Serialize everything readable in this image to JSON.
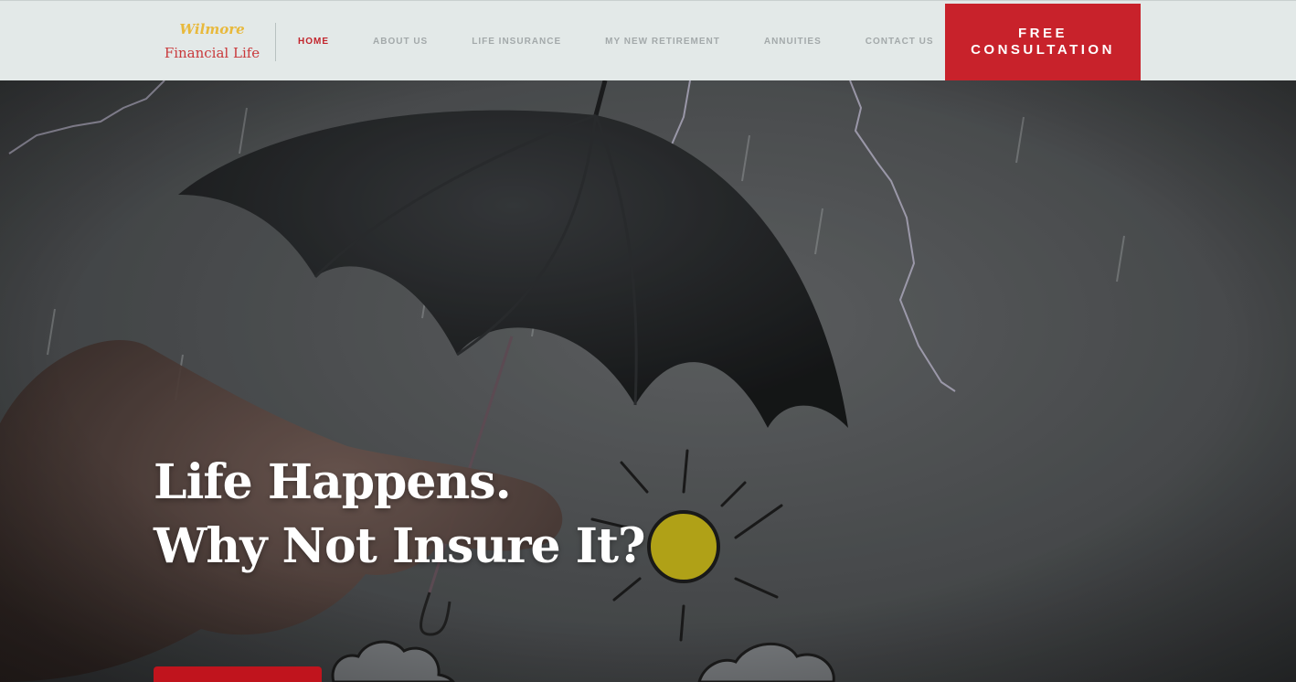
{
  "logo": {
    "line1": "Wilmore",
    "line2": "Financial Life"
  },
  "nav": {
    "items": [
      {
        "label": "HOME",
        "active": true
      },
      {
        "label": "ABOUT US",
        "active": false
      },
      {
        "label": "LIFE INSURANCE",
        "active": false
      },
      {
        "label": "MY NEW RETIREMENT",
        "active": false
      },
      {
        "label": "ANNUITIES",
        "active": false
      },
      {
        "label": "CONTACT US",
        "active": false
      }
    ]
  },
  "cta": {
    "line1": "FREE",
    "line2": "CONSULTATION"
  },
  "hero": {
    "headline_line1": "Life Happens.",
    "headline_line2": "Why Not Insure It?",
    "image_icons": [
      "umbrella-icon",
      "hand-icon",
      "sun-icon",
      "cloud-icon",
      "lightning-icon",
      "rain-icon"
    ]
  },
  "colors": {
    "brand_red": "#c8222b",
    "logo_gold": "#e8b93c",
    "logo_red": "#c9393b",
    "header_bg": "#e3e9e8",
    "nav_text": "#a3a9aa",
    "nav_active": "#c2252c"
  }
}
